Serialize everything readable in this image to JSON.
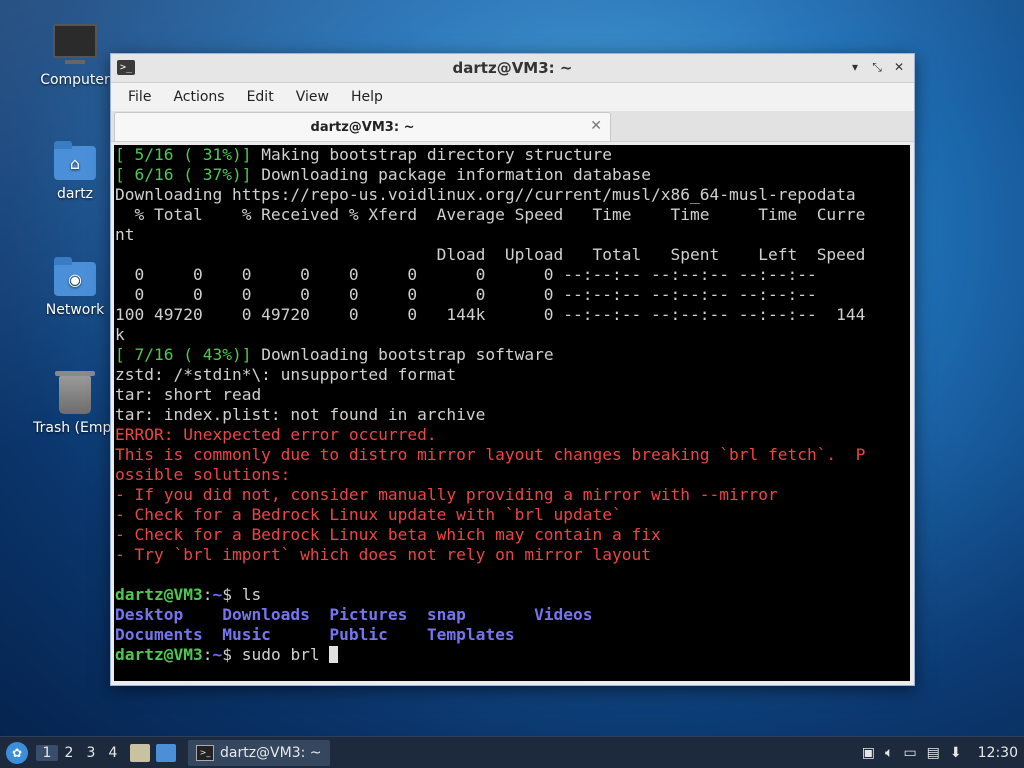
{
  "desktop": {
    "icons": [
      {
        "label": "Computer",
        "icon": "computer-icon"
      },
      {
        "label": "dartz",
        "icon": "home-folder-icon"
      },
      {
        "label": "Network",
        "icon": "network-folder-icon"
      },
      {
        "label": "Trash (Empt",
        "icon": "trash-icon"
      }
    ]
  },
  "window": {
    "title": "dartz@VM3: ~",
    "menu": [
      "File",
      "Actions",
      "Edit",
      "View",
      "Help"
    ],
    "tab_label": "dartz@VM3: ~",
    "controls": {
      "minimize": "▾",
      "maximize": "⤡",
      "close": "✕"
    }
  },
  "terminal": {
    "lines": [
      {
        "parts": [
          {
            "t": "[ 5/16 ( 31%)]",
            "c": "green"
          },
          {
            "t": " Making bootstrap directory structure",
            "c": ""
          }
        ]
      },
      {
        "parts": [
          {
            "t": "[ 6/16 ( 37%)]",
            "c": "green"
          },
          {
            "t": " Downloading package information database",
            "c": ""
          }
        ]
      },
      {
        "parts": [
          {
            "t": "Downloading https://repo-us.voidlinux.org//current/musl/x86_64-musl-repodata",
            "c": ""
          }
        ]
      },
      {
        "parts": [
          {
            "t": "  % Total    % Received % Xferd  Average Speed   Time    Time     Time  Curre",
            "c": ""
          }
        ]
      },
      {
        "parts": [
          {
            "t": "nt",
            "c": ""
          }
        ]
      },
      {
        "parts": [
          {
            "t": "                                 Dload  Upload   Total   Spent    Left  Speed",
            "c": ""
          }
        ]
      },
      {
        "parts": [
          {
            "t": "  0     0    0     0    0     0      0      0 --:--:-- --:--:-- --:--:--",
            "c": ""
          }
        ]
      },
      {
        "parts": [
          {
            "t": "  0     0    0     0    0     0      0      0 --:--:-- --:--:-- --:--:--",
            "c": ""
          }
        ]
      },
      {
        "parts": [
          {
            "t": "100 49720    0 49720    0     0   144k      0 --:--:-- --:--:-- --:--:--  144",
            "c": ""
          }
        ]
      },
      {
        "parts": [
          {
            "t": "k",
            "c": ""
          }
        ]
      },
      {
        "parts": [
          {
            "t": "[ 7/16 ( 43%)]",
            "c": "green"
          },
          {
            "t": " Downloading bootstrap software",
            "c": ""
          }
        ]
      },
      {
        "parts": [
          {
            "t": "zstd: /*stdin*\\: unsupported format",
            "c": ""
          }
        ]
      },
      {
        "parts": [
          {
            "t": "tar: short read",
            "c": ""
          }
        ]
      },
      {
        "parts": [
          {
            "t": "tar: index.plist: not found in archive",
            "c": ""
          }
        ]
      },
      {
        "parts": [
          {
            "t": "ERROR: Unexpected error occurred.",
            "c": "red"
          }
        ]
      },
      {
        "parts": [
          {
            "t": "This is commonly due to distro mirror layout changes breaking `brl fetch`.  P",
            "c": "red"
          }
        ]
      },
      {
        "parts": [
          {
            "t": "ossible solutions:",
            "c": "red"
          }
        ]
      },
      {
        "parts": [
          {
            "t": "- If you did not, consider manually providing a mirror with --mirror",
            "c": "red"
          }
        ]
      },
      {
        "parts": [
          {
            "t": "- Check for a Bedrock Linux update with `brl update`",
            "c": "red"
          }
        ]
      },
      {
        "parts": [
          {
            "t": "- Check for a Bedrock Linux beta which may contain a fix",
            "c": "red"
          }
        ]
      },
      {
        "parts": [
          {
            "t": "- Try `brl import` which does not rely on mirror layout",
            "c": "red"
          }
        ]
      },
      {
        "parts": [
          {
            "t": "",
            "c": ""
          }
        ]
      },
      {
        "parts": [
          {
            "t": "dartz@VM3",
            "c": "prompt"
          },
          {
            "t": ":",
            "c": ""
          },
          {
            "t": "~",
            "c": "path"
          },
          {
            "t": "$ ls",
            "c": ""
          }
        ]
      },
      {
        "parts": [
          {
            "t": "Desktop    Downloads  Pictures  snap       Videos",
            "c": "blue"
          }
        ]
      },
      {
        "parts": [
          {
            "t": "Documents  Music      Public    Templates",
            "c": "blue"
          }
        ]
      },
      {
        "parts": [
          {
            "t": "dartz@VM3",
            "c": "prompt"
          },
          {
            "t": ":",
            "c": ""
          },
          {
            "t": "~",
            "c": "path"
          },
          {
            "t": "$ sudo brl ",
            "c": ""
          }
        ],
        "cursor": true
      }
    ]
  },
  "taskbar": {
    "workspaces": [
      "1",
      "2",
      "3",
      "4"
    ],
    "task_label": "dartz@VM3: ~",
    "clock": "12:30"
  }
}
